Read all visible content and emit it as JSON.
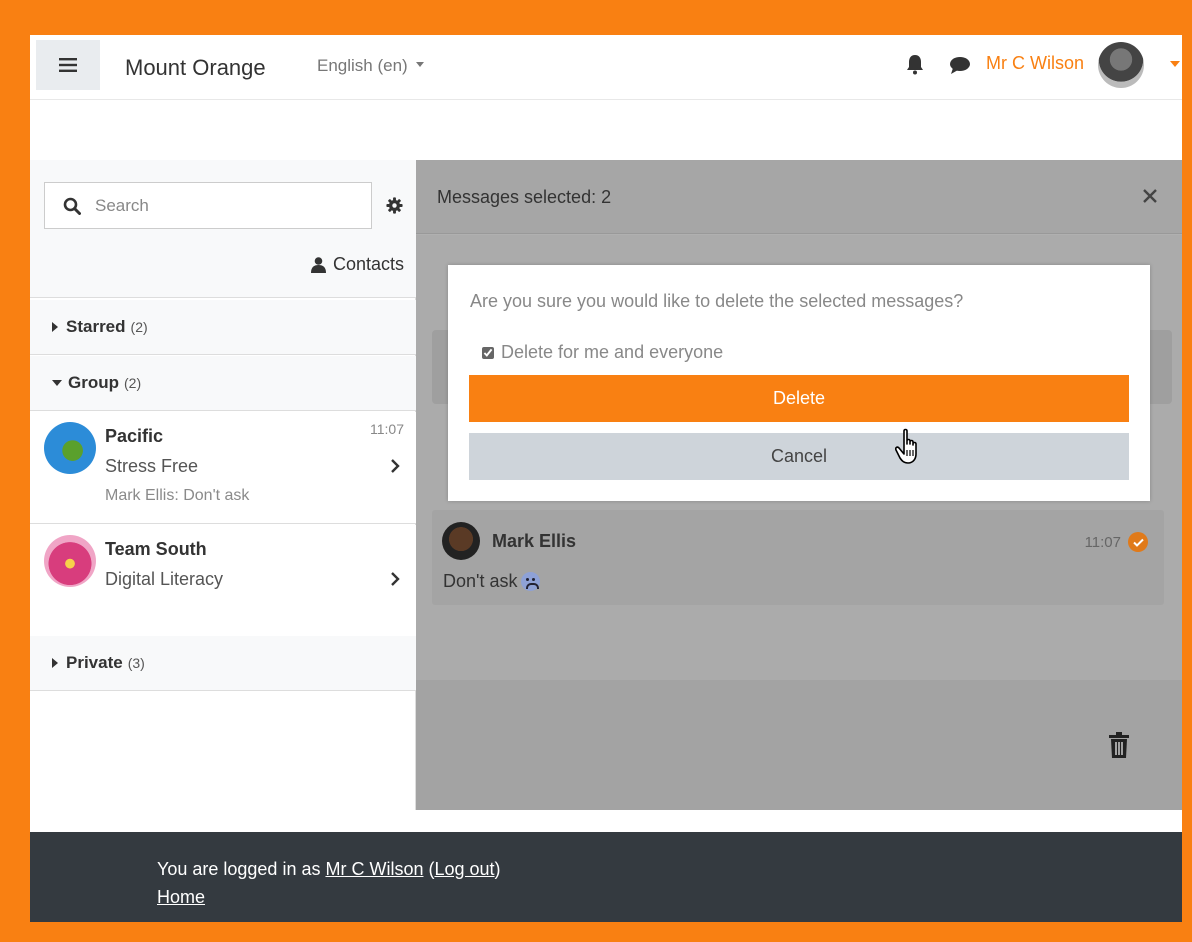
{
  "header": {
    "site_name": "Mount Orange",
    "language": "English (en)",
    "user_name": "Mr C Wilson"
  },
  "drawer": {
    "search_placeholder": "Search",
    "contacts_label": "Contacts",
    "sections": {
      "starred": {
        "label": "Starred",
        "count": "(2)"
      },
      "group": {
        "label": "Group",
        "count": "(2)"
      },
      "private": {
        "label": "Private",
        "count": "(3)"
      }
    },
    "conversations": [
      {
        "name": "Pacific",
        "subtitle": "Stress Free",
        "preview": "Mark Ellis: Don't ask",
        "time": "11:07"
      },
      {
        "name": "Team South",
        "subtitle": "Digital Literacy",
        "preview": "",
        "time": ""
      }
    ]
  },
  "panel": {
    "selected_label": "Messages selected: 2",
    "message": {
      "author": "Mark Ellis",
      "time": "11:07",
      "text": "Don't ask"
    }
  },
  "modal": {
    "question": "Are you sure you would like to delete the selected messages?",
    "checkbox_label": "Delete for me and everyone",
    "checkbox_checked": true,
    "delete_label": "Delete",
    "cancel_label": "Cancel"
  },
  "footer": {
    "logged_in_prefix": "You are logged in as ",
    "user_link": "Mr C Wilson",
    "logout_open": " (",
    "logout_link": "Log out",
    "logout_close": ")",
    "home_link": "Home"
  },
  "colors": {
    "brand_orange": "#f98012",
    "footer_bg": "#343a40",
    "cancel_bg": "#ced4da"
  },
  "icons": [
    "hamburger-icon",
    "bell-icon",
    "chat-icon",
    "search-icon",
    "gear-icon",
    "user-icon",
    "chevron-right-icon",
    "close-icon",
    "check-icon",
    "trash-icon",
    "hand-cursor-icon"
  ]
}
